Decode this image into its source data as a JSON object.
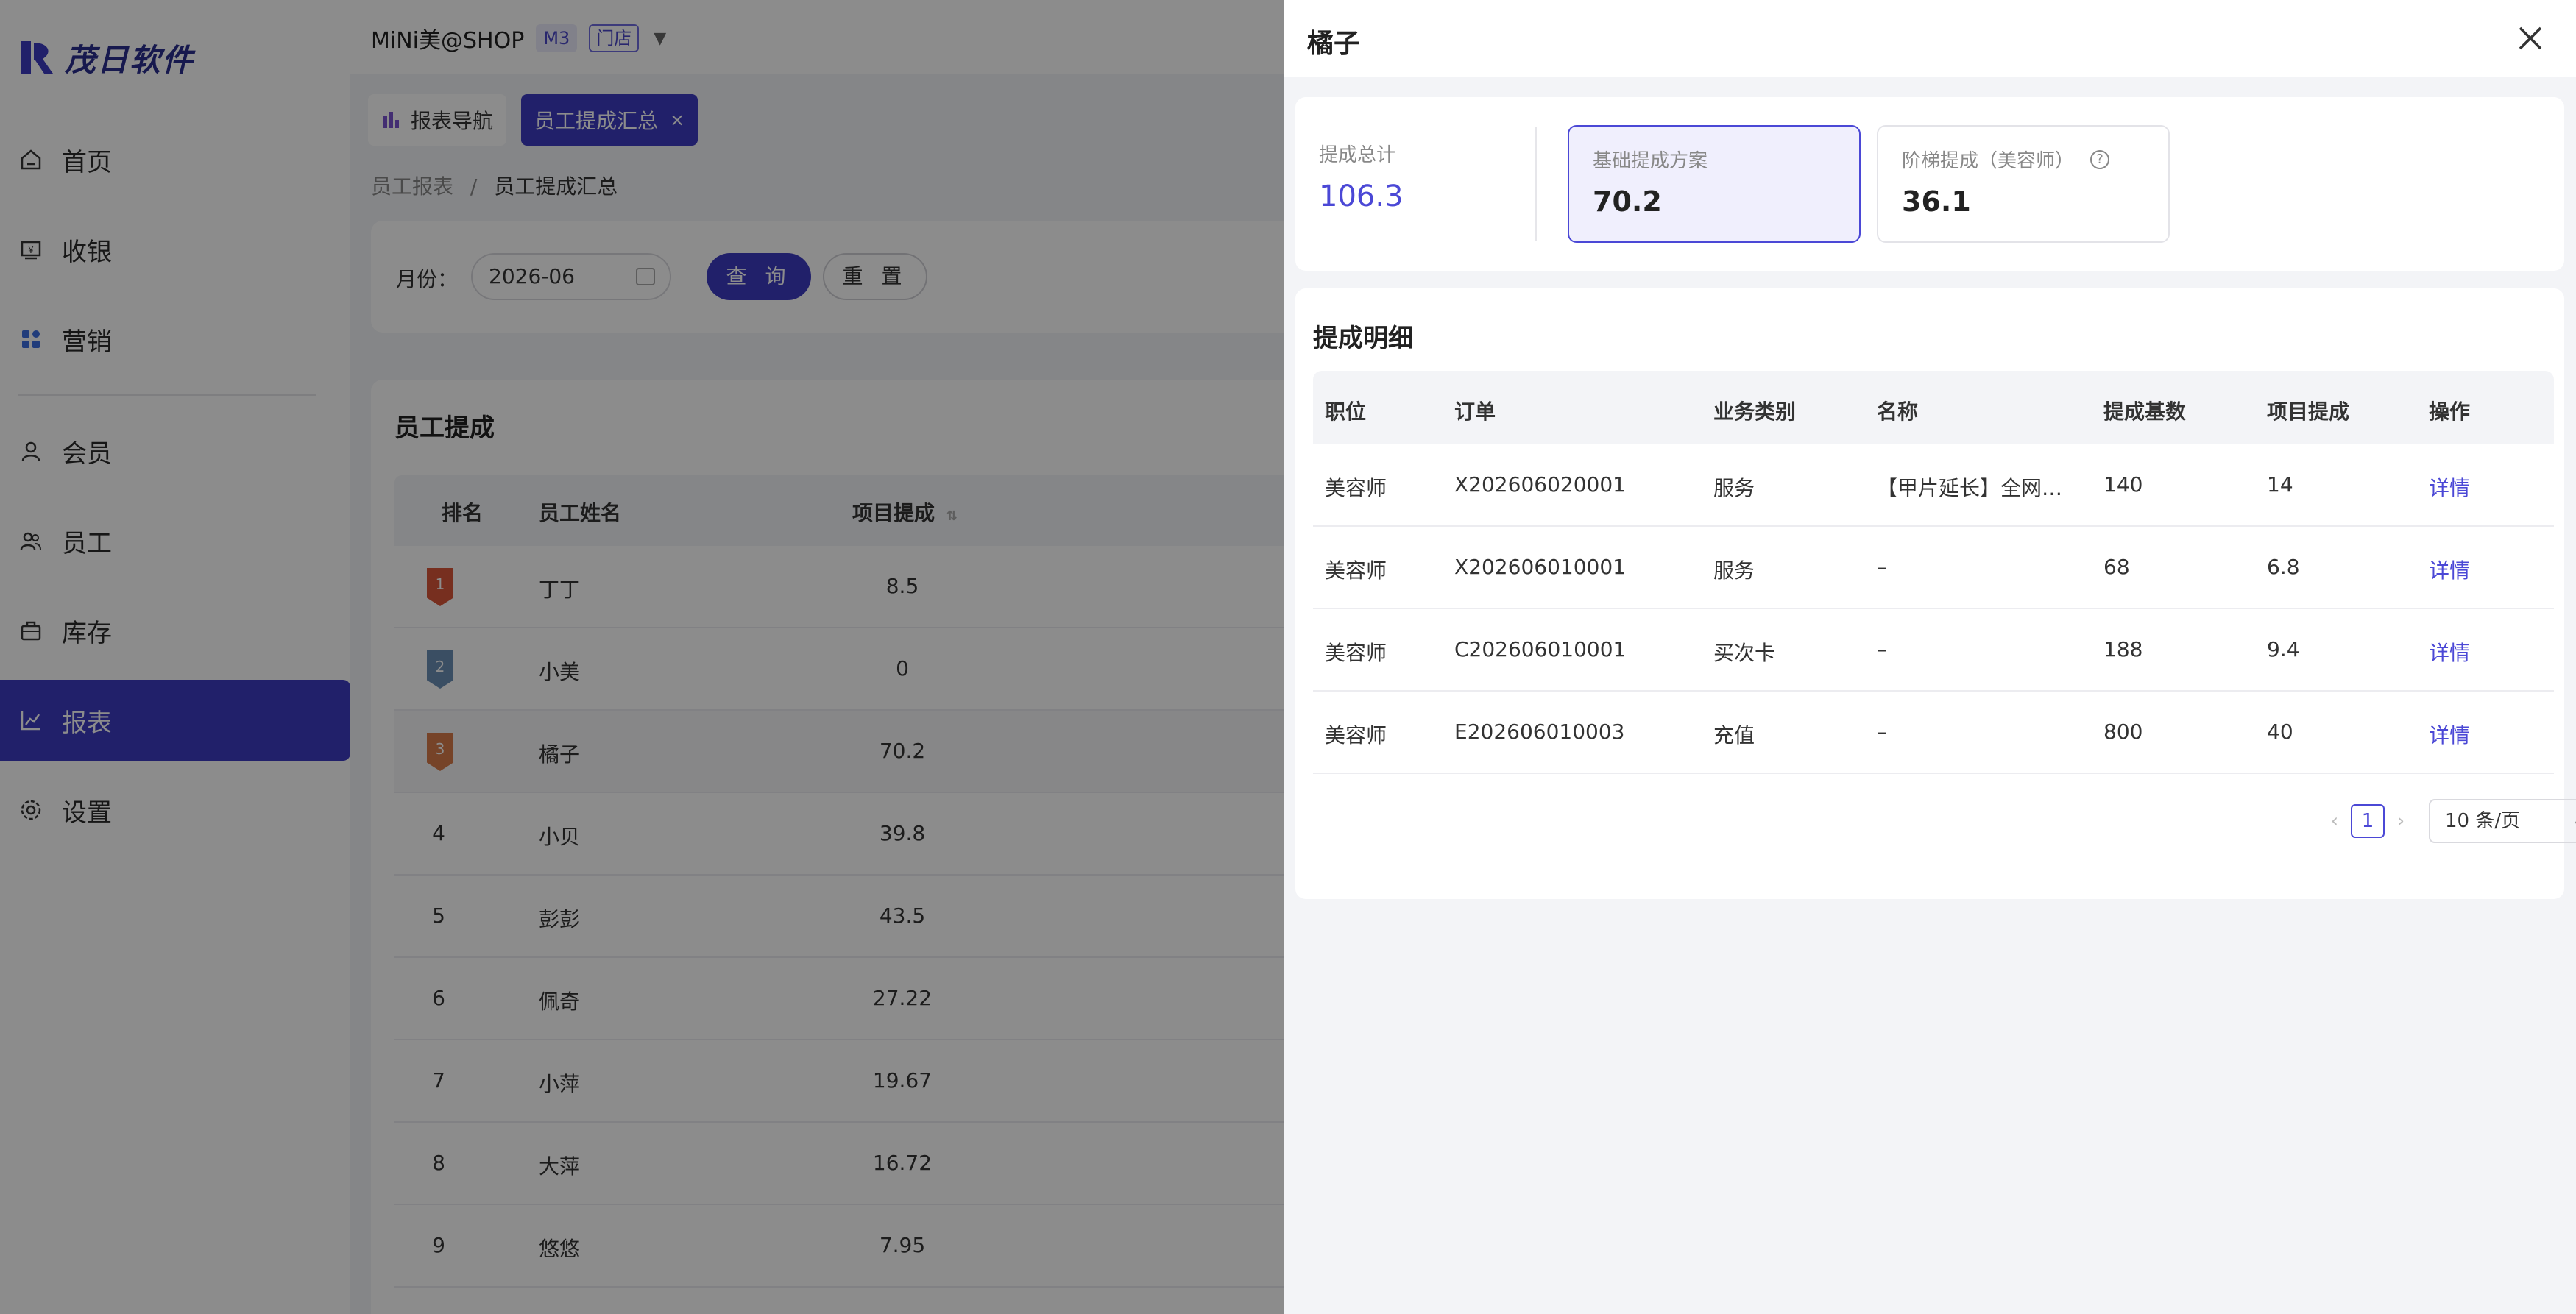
{
  "brand": {
    "name": "茂日软件",
    "accent": "#3d3bc2"
  },
  "shop": {
    "name": "MiNi美@SHOP",
    "tag1": "M3",
    "tag2": "门店"
  },
  "sidebar": {
    "items": [
      {
        "label": "首页",
        "icon": "home-icon"
      },
      {
        "label": "收银",
        "icon": "cashier-icon"
      },
      {
        "label": "营销",
        "icon": "marketing-icon"
      },
      {
        "label": "会员",
        "icon": "member-icon"
      },
      {
        "label": "员工",
        "icon": "staff-icon"
      },
      {
        "label": "库存",
        "icon": "inventory-icon"
      },
      {
        "label": "报表",
        "icon": "report-icon",
        "active": true
      },
      {
        "label": "设置",
        "icon": "settings-icon"
      }
    ]
  },
  "tabs": {
    "nav_label": "报表导航",
    "current_label": "员工提成汇总",
    "close": "×"
  },
  "breadcrumb": {
    "parent": "员工报表",
    "sep": "/",
    "current": "员工提成汇总"
  },
  "filter": {
    "month_label": "月份：",
    "month_value": "2026-06",
    "query": "查 询",
    "reset": "重 置"
  },
  "employee_table": {
    "title": "员工提成",
    "headers": {
      "rank": "排名",
      "name": "员工姓名",
      "commission": "项目提成"
    },
    "rows": [
      {
        "rank": "1",
        "name": "丁丁",
        "value": "8.5"
      },
      {
        "rank": "2",
        "name": "小美",
        "value": "0"
      },
      {
        "rank": "3",
        "name": "橘子",
        "value": "70.2"
      },
      {
        "rank": "4",
        "name": "小贝",
        "value": "39.8"
      },
      {
        "rank": "5",
        "name": "彭彭",
        "value": "43.5"
      },
      {
        "rank": "6",
        "name": "佩奇",
        "value": "27.22"
      },
      {
        "rank": "7",
        "name": "小萍",
        "value": "19.67"
      },
      {
        "rank": "8",
        "name": "大萍",
        "value": "16.72"
      },
      {
        "rank": "9",
        "name": "悠悠",
        "value": "7.95"
      }
    ]
  },
  "drawer": {
    "title": "橘子",
    "summary": {
      "total_label": "提成总计",
      "total_value": "106.3",
      "basic_label": "基础提成方案",
      "basic_value": "70.2",
      "tier_label": "阶梯提成（美容师）",
      "tier_value": "36.1"
    },
    "detail": {
      "title": "提成明细",
      "headers": {
        "position": "职位",
        "order": "订单",
        "category": "业务类别",
        "name": "名称",
        "base": "提成基数",
        "commission": "项目提成",
        "action": "操作"
      },
      "rows": [
        {
          "position": "美容师",
          "order": "X202606020001",
          "category": "服务",
          "name": "【甲片延长】全网…",
          "base": "140",
          "commission": "14",
          "action": "详情"
        },
        {
          "position": "美容师",
          "order": "X202606010001",
          "category": "服务",
          "name": "–",
          "base": "68",
          "commission": "6.8",
          "action": "详情"
        },
        {
          "position": "美容师",
          "order": "C202606010001",
          "category": "买次卡",
          "name": "–",
          "base": "188",
          "commission": "9.4",
          "action": "详情"
        },
        {
          "position": "美容师",
          "order": "E202606010003",
          "category": "充值",
          "name": "–",
          "base": "800",
          "commission": "40",
          "action": "详情"
        }
      ]
    },
    "pagination": {
      "current_page": "1",
      "page_size": "10 条/页"
    }
  }
}
